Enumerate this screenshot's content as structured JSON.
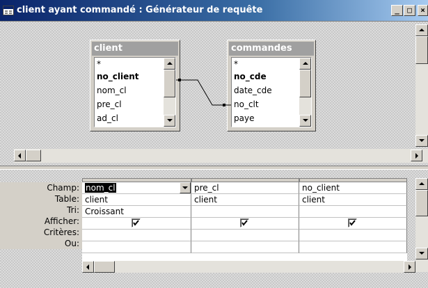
{
  "window": {
    "title": "client ayant commandé : Générateur de requête",
    "controls": {
      "minimize": "_",
      "maximize": "□",
      "close": "×"
    }
  },
  "tables": [
    {
      "name": "client",
      "fields": [
        "*",
        "no_client",
        "nom_cl",
        "pre_cl",
        "ad_cl"
      ],
      "key_field": "no_client"
    },
    {
      "name": "commandes",
      "fields": [
        "*",
        "no_cde",
        "date_cde",
        "no_clt",
        "paye"
      ],
      "key_field": "no_cde"
    }
  ],
  "grid": {
    "row_labels": [
      "Champ:",
      "Table:",
      "Tri:",
      "Afficher:",
      "Critères:",
      "Ou:"
    ],
    "columns": [
      {
        "champ": "nom_cl",
        "table": "client",
        "tri": "Croissant",
        "afficher": true
      },
      {
        "champ": "pre_cl",
        "table": "client",
        "tri": "",
        "afficher": true
      },
      {
        "champ": "no_client",
        "table": "client",
        "tri": "",
        "afficher": true
      }
    ]
  },
  "icons": {
    "window_icon": "query-window-icon",
    "scroll_up": "scroll-up-icon",
    "scroll_down": "scroll-down-icon",
    "scroll_left": "scroll-left-icon",
    "scroll_right": "scroll-right-icon",
    "dropdown": "chevron-down-icon",
    "checkbox": "checkmark-icon"
  },
  "colors": {
    "title_start": "#0a246a",
    "title_end": "#a6caf0",
    "table_header": "#a0a0a0",
    "selection": "#000000"
  }
}
